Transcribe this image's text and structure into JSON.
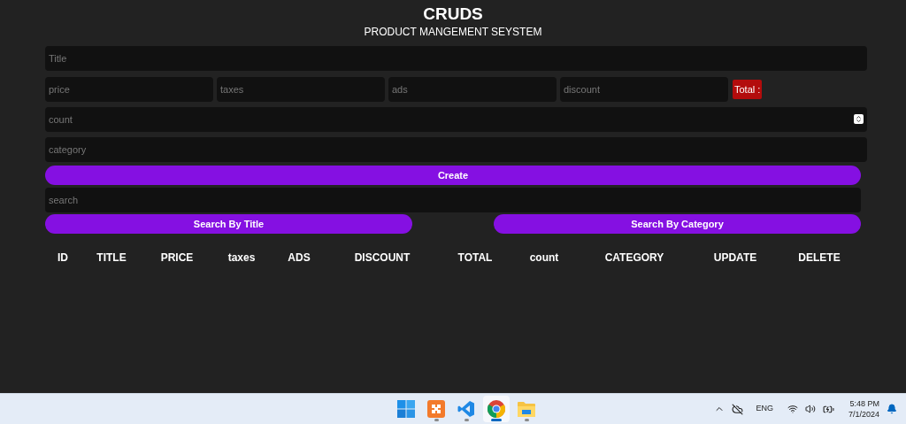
{
  "header": {
    "title": "CRUDS",
    "subtitle": "PRODUCT MANGEMENT SEYSTEM"
  },
  "form": {
    "title": {
      "placeholder": "Title"
    },
    "prices": [
      {
        "placeholder": "price"
      },
      {
        "placeholder": "taxes"
      },
      {
        "placeholder": "ads"
      },
      {
        "placeholder": "discount"
      }
    ],
    "total": "Total :",
    "count": {
      "placeholder": "count"
    },
    "category": {
      "placeholder": "category"
    },
    "create_button": "Create"
  },
  "search": {
    "placeholder": "search",
    "buttons": [
      "Search By Title",
      "Search By Category"
    ]
  },
  "table": {
    "columns": [
      "ID",
      "TITLE",
      "PRICE",
      "taxes",
      "ADS",
      "DISCOUNT",
      "TOTAL",
      "count",
      "CATEGORY",
      "UPDATE",
      "DELETE"
    ]
  },
  "taskbar": {
    "apps": [
      {
        "kind": "start",
        "selected": false,
        "running": false
      },
      {
        "kind": "xampp",
        "selected": false,
        "running": true
      },
      {
        "kind": "vscode",
        "selected": false,
        "running": true
      },
      {
        "kind": "chrome",
        "selected": true,
        "running": true
      },
      {
        "kind": "files",
        "selected": false,
        "running": true
      }
    ],
    "language": "ENG",
    "time": "5:48 PM",
    "date": "7/1/2024"
  }
}
